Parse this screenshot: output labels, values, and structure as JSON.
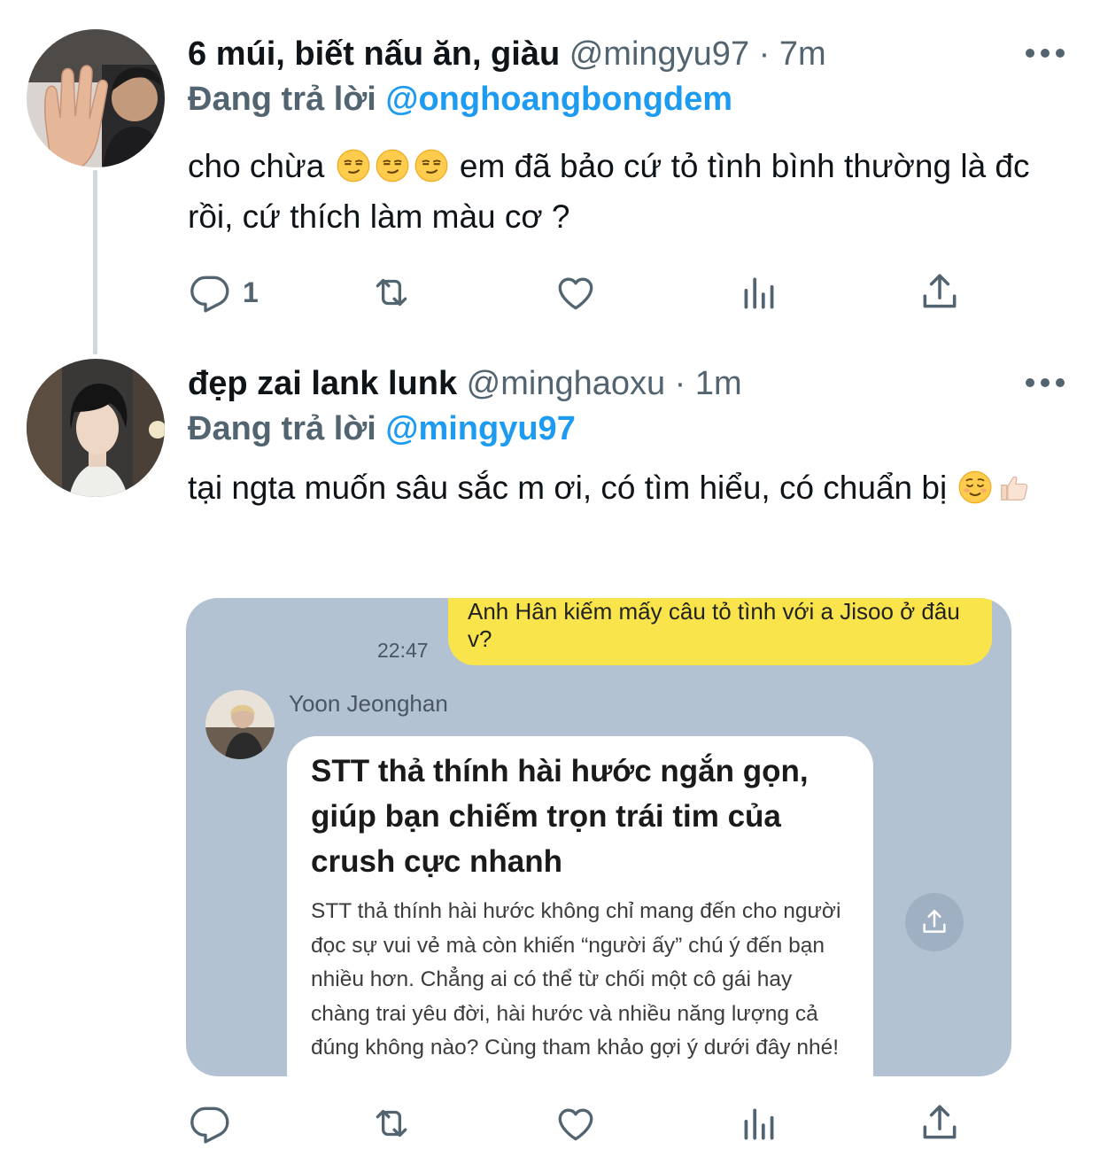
{
  "tweets": [
    {
      "name": "6 múi, biết nấu ăn, giàu",
      "handle": "@mingyu97",
      "dot": " · ",
      "time": "7m",
      "replying_label": "Đang trả lời",
      "replying_to": "@onghoangbongdem",
      "text_before": "cho chừa",
      "text_after": " em đã bảo cứ tỏ tình bình thường là đc rồi, cứ thích làm màu cơ ?",
      "reply_count": "1",
      "emojis": [
        "smirking-face",
        "smirking-face",
        "smirking-face"
      ]
    },
    {
      "name": "đẹp zai lank lunk",
      "handle": "@minghaoxu",
      "dot": " · ",
      "time": "1m",
      "replying_label": "Đang trả lời",
      "replying_to": "@mingyu97",
      "text_before": "tại ngta muốn sâu sắc m ơi, có tìm hiểu, có chuẩn bị",
      "emojis": [
        "relieved-face",
        "thumbs-up"
      ]
    }
  ],
  "media": {
    "outgoing_message": "Anh Hân kiếm mấy câu tỏ tình với a Jisoo ở đâu v?",
    "outgoing_time": "22:47",
    "sender_name": "Yoon Jeonghan",
    "card_title": "STT thả thính hài hước ngắn gọn, giúp bạn chiếm trọn trái tim của crush cực nhanh",
    "card_body": "STT thả thính hài hước không chỉ mang đến cho người đọc sự vui vẻ mà còn khiến “người ấy” chú ý đến bạn nhiều hơn. Chẳng ai có thể từ chối một cô gái hay chàng trai yêu đời, hài hước và nhiều năng lượng cả đúng không nào? Cùng tham khảo gợi ý dưới đây nhé!"
  },
  "colors": {
    "link": "#1d9bf0",
    "secondary_text": "#536471",
    "thread_line": "#cfd9de",
    "chat_background": "#b2c2d3",
    "outgoing_bubble": "#f9e54b"
  },
  "icons": [
    "reply-icon",
    "retweet-icon",
    "like-icon",
    "analytics-icon",
    "share-icon",
    "more-icon"
  ]
}
